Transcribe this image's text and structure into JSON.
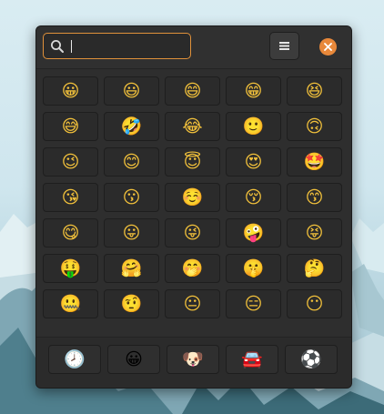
{
  "search": {
    "value": "",
    "placeholder": ""
  },
  "icons": {
    "search": "search-icon",
    "menu": "hamburger-menu-icon",
    "close": "close-icon"
  },
  "colors": {
    "window_bg": "#2e2e2e",
    "accent_orange": "#e8883a",
    "search_focus_border": "#e0913a"
  },
  "emojis": [
    "😀",
    "😃",
    "😄",
    "😁",
    "😆",
    "😅",
    "🤣",
    "😂",
    "🙂",
    "🙃",
    "😉",
    "😊",
    "😇",
    "😍",
    "🤩",
    "😘",
    "😗",
    "☺️",
    "😚",
    "😙",
    "😋",
    "😛",
    "😜",
    "🤪",
    "😝",
    "🤑",
    "🤗",
    "🤭",
    "🤫",
    "🤔",
    "🤐",
    "🤨",
    "😐",
    "😑",
    "😶"
  ],
  "categories": [
    {
      "icon": "🕗",
      "name": "recent-category-icon"
    },
    {
      "icon": "😀",
      "name": "smileys-category-icon"
    },
    {
      "icon": "🐶",
      "name": "animals-category-icon"
    },
    {
      "icon": "🚘",
      "name": "travel-category-icon"
    },
    {
      "icon": "⚽",
      "name": "activities-category-icon"
    }
  ]
}
